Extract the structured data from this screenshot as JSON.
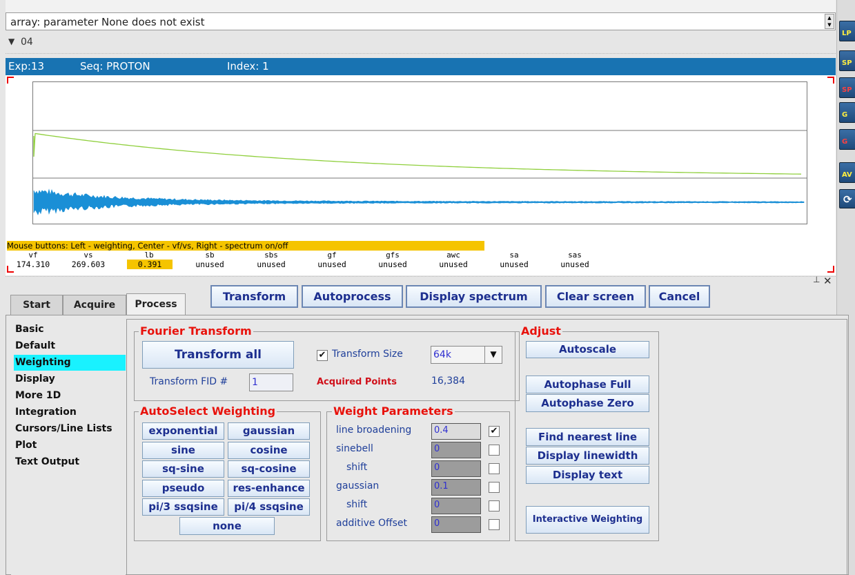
{
  "top_message": "array: parameter None does not exist",
  "viewport": {
    "label": "04"
  },
  "header": {
    "exp": "Exp:13",
    "seq": "Seq: PROTON",
    "index": "Index: 1"
  },
  "status_hint": "Mouse buttons: Left - weighting, Center - vf/vs, Right - spectrum on/off",
  "params": [
    {
      "name": "vf",
      "value": "174.310",
      "highlight": false
    },
    {
      "name": "vs",
      "value": "269.603",
      "highlight": false
    },
    {
      "name": "lb",
      "value": "0.391",
      "highlight": true
    },
    {
      "name": "sb",
      "value": "unused",
      "highlight": false
    },
    {
      "name": "sbs",
      "value": "unused",
      "highlight": false
    },
    {
      "name": "gf",
      "value": "unused",
      "highlight": false
    },
    {
      "name": "gfs",
      "value": "unused",
      "highlight": false
    },
    {
      "name": "awc",
      "value": "unused",
      "highlight": false
    },
    {
      "name": "sa",
      "value": "unused",
      "highlight": false
    },
    {
      "name": "sas",
      "value": "unused",
      "highlight": false
    }
  ],
  "actions": {
    "transform": "Transform",
    "autoprocess": "Autoprocess",
    "display_spectrum": "Display spectrum",
    "clear_screen": "Clear screen",
    "cancel": "Cancel"
  },
  "tabs": [
    "Start",
    "Acquire",
    "Process"
  ],
  "active_tab": "Process",
  "sidebar": [
    "Basic",
    "Default",
    "Weighting",
    "Display",
    "More 1D",
    "Integration",
    "Cursors/Line Lists",
    "Plot",
    "Text Output"
  ],
  "sidebar_selected": "Weighting",
  "fourier": {
    "title": "Fourier Transform",
    "transform_all": "Transform all",
    "transform_size_label": "Transform Size",
    "transform_size_checked": true,
    "transform_size_value": "64k",
    "fid_label": "Transform FID #",
    "fid_value": "1",
    "acquired_label": "Acquired Points",
    "acquired_value": "16,384"
  },
  "autoselect": {
    "title": "AutoSelect Weighting",
    "buttons": [
      "exponential",
      "gaussian",
      "sine",
      "cosine",
      "sq-sine",
      "sq-cosine",
      "pseudo",
      "res-enhance",
      "pi/3 ssqsine",
      "pi/4 ssqsine"
    ],
    "none": "none"
  },
  "weight_params": {
    "title": "Weight Parameters",
    "rows": [
      {
        "label": "line broadening",
        "value": "0.4",
        "checked": true
      },
      {
        "label": "sinebell",
        "value": "0",
        "checked": false
      },
      {
        "label": "shift",
        "value": "0",
        "checked": false
      },
      {
        "label": "gaussian",
        "value": "0.1",
        "checked": false
      },
      {
        "label": "shift",
        "value": "0",
        "checked": false
      },
      {
        "label": "additive Offset",
        "value": "0",
        "checked": false
      }
    ]
  },
  "adjust": {
    "title": "Adjust",
    "autoscale": "Autoscale",
    "autophase_full": "Autophase Full",
    "autophase_zero": "Autophase Zero",
    "find_nearest_line": "Find nearest line",
    "display_linewidth": "Display linewidth",
    "display_text": "Display text",
    "interactive_weighting": "Interactive Weighting"
  },
  "colors": {
    "header_bg": "#1873b2",
    "weighting_curve": "#8fcf3c",
    "fid": "#1a8fd6",
    "hint_bg": "#f5c400",
    "selected": "#19f2ff",
    "group_title": "#e8120c"
  },
  "icons": [
    "linear-prediction-icon",
    "spectrum-icon",
    "spectrum-red-icon",
    "gaussian-icon",
    "gaussian-red-icon",
    "averaging-icon",
    "refresh-icon"
  ]
}
